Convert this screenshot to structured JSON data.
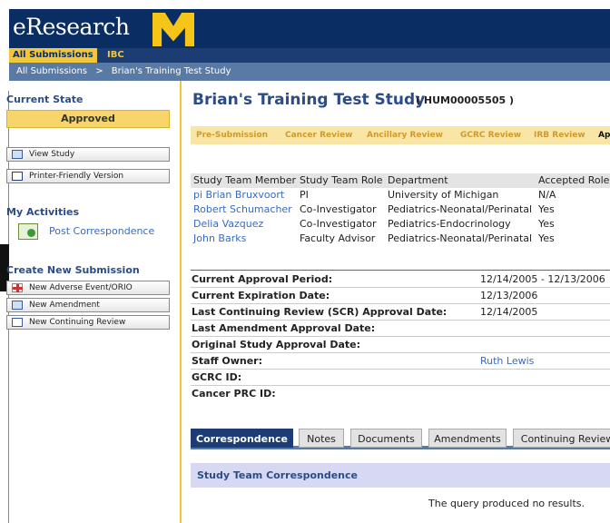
{
  "header": {
    "app_name": "eResearch"
  },
  "top_tabs": {
    "all_submissions": "All Submissions",
    "ibc": "IBC"
  },
  "breadcrumb": {
    "root": "All Submissions",
    "sep": ">",
    "current": "Brian's Training Test Study"
  },
  "sidebar": {
    "current_state_heading": "Current State",
    "state_value": "Approved",
    "view_study": "View Study",
    "printer_friendly": "Printer-Friendly Version",
    "activities_heading": "My Activities",
    "post_correspondence": "Post Correspondence",
    "create_heading": "Create New Submission",
    "new_adverse": "New Adverse Event/ORIO",
    "new_amendment": "New Amendment",
    "new_continuing": "New Continuing Review"
  },
  "main": {
    "title": "Brian's Training Test Study",
    "study_id": "( HUM00005505 )",
    "subtabs": [
      "Pre-Submission",
      "Cancer Review",
      "Ancillary Review",
      "GCRC Review",
      "IRB Review",
      "Ap"
    ],
    "team_table": {
      "headers": [
        "Study Team Member",
        "Study Team Role",
        "Department",
        "Accepted Role"
      ],
      "rows": [
        [
          "pi Brian Bruxvoort",
          "PI",
          "University of Michigan",
          "N/A"
        ],
        [
          "Robert Schumacher",
          "Co-Investigator",
          "Pediatrics-Neonatal/Perinatal",
          "Yes"
        ],
        [
          "Delia Vazquez",
          "Co-Investigator",
          "Pediatrics-Endocrinology",
          "Yes"
        ],
        [
          "John Barks",
          "Faculty Advisor",
          "Pediatrics-Neonatal/Perinatal",
          "Yes"
        ]
      ]
    },
    "details": [
      {
        "label": "Current Approval Period:",
        "value": "12/14/2005 - 12/13/2006"
      },
      {
        "label": "Current Expiration Date:",
        "value": "12/13/2006"
      },
      {
        "label": "Last Continuing Review (SCR) Approval Date:",
        "value": "12/14/2005"
      },
      {
        "label": "Last Amendment Approval Date:",
        "value": ""
      },
      {
        "label": "Original Study Approval Date:",
        "value": ""
      },
      {
        "label": "Staff Owner:",
        "value": "Ruth Lewis"
      },
      {
        "label": "GCRC ID:",
        "value": ""
      },
      {
        "label": "Cancer PRC ID:",
        "value": ""
      }
    ],
    "bottom_tabs": [
      "Correspondence",
      "Notes",
      "Documents",
      "Amendments",
      "Continuing Review"
    ],
    "correspondence_heading": "Study Team Correspondence",
    "no_results": "The query produced no results."
  }
}
